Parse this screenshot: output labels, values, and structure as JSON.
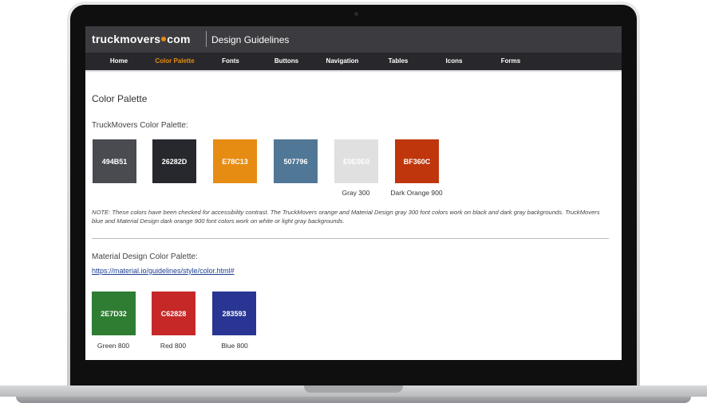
{
  "brand": {
    "logo_left": "truckmovers",
    "logo_right": "com",
    "site_title": "Design Guidelines"
  },
  "nav": [
    {
      "label": "Home"
    },
    {
      "label": "Color Palette",
      "active": true
    },
    {
      "label": "Fonts"
    },
    {
      "label": "Buttons"
    },
    {
      "label": "Navigation"
    },
    {
      "label": "Tables"
    },
    {
      "label": "Icons"
    },
    {
      "label": "Forms"
    }
  ],
  "page": {
    "title": "Color Palette",
    "truckmovers_heading": "TruckMovers Color Palette:",
    "truckmovers_swatches": [
      {
        "code": "494B51",
        "color": "#494B51",
        "label": ""
      },
      {
        "code": "26282D",
        "color": "#26282D",
        "label": ""
      },
      {
        "code": "E78C13",
        "color": "#E78C13",
        "label": ""
      },
      {
        "code": "507796",
        "color": "#507796",
        "label": ""
      },
      {
        "code": "E0E0E0",
        "color": "#E0E0E0",
        "label": "Gray 300"
      },
      {
        "code": "BF360C",
        "color": "#BF360C",
        "label": "Dark Orange 900"
      }
    ],
    "note": "NOTE: These colors have been checked for accessibility contrast. The TruckMovers orange and Material Design gray 300 font colors work on black and dark gray backgrounds. TruckMovers blue and Material Design dark orange 900 font colors work on white or light gray backgrounds.",
    "material_heading": "Material Design Color Palette:",
    "material_link": "https://material.io/guidelines/style/color.html#",
    "material_swatches": [
      {
        "code": "2E7D32",
        "color": "#2E7D32",
        "label": "Green 800"
      },
      {
        "code": "C62828",
        "color": "#C62828",
        "label": "Red 800"
      },
      {
        "code": "283593",
        "color": "#283593",
        "label": "Blue 800"
      }
    ]
  }
}
